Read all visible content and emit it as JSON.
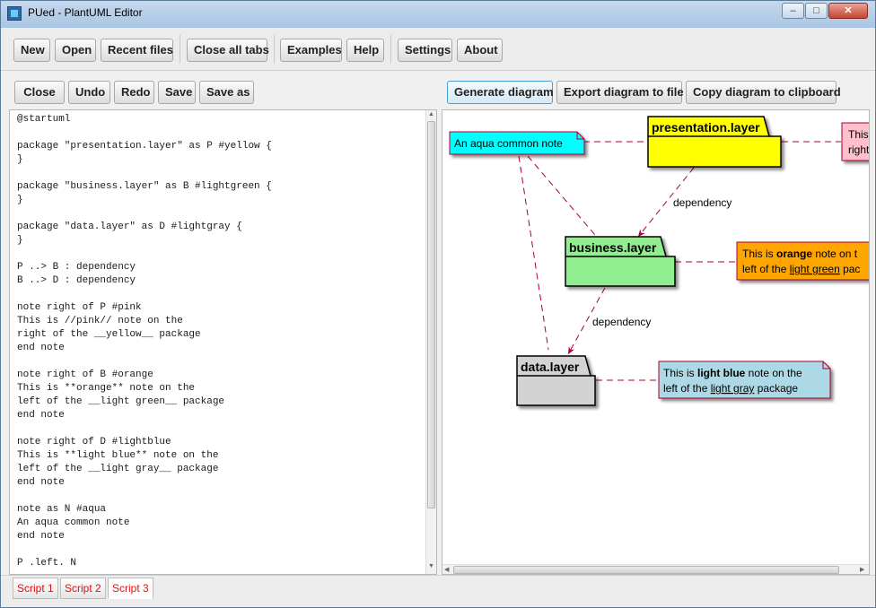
{
  "window": {
    "title": "PUed - PlantUML Editor",
    "min": "–",
    "max": "□",
    "close": "✕"
  },
  "toolbar": {
    "new": "New",
    "open": "Open",
    "recent": "Recent files",
    "close_all": "Close all tabs",
    "examples": "Examples",
    "help": "Help",
    "settings": "Settings",
    "about": "About"
  },
  "editor_toolbar": {
    "close": "Close",
    "undo": "Undo",
    "redo": "Redo",
    "save": "Save",
    "save_as": "Save as"
  },
  "diagram_toolbar": {
    "generate": "Generate diagram",
    "export": "Export diagram to file",
    "copy": "Copy diagram to clipboard"
  },
  "code": "@startuml\n\npackage \"presentation.layer\" as P #yellow {\n}\n\npackage \"business.layer\" as B #lightgreen {\n}\n\npackage \"data.layer\" as D #lightgray {\n}\n\nP ..> B : dependency\nB ..> D : dependency\n\nnote right of P #pink\nThis is //pink// note on the\nright of the __yellow__ package\nend note\n\nnote right of B #orange\nThis is **orange** note on the\nleft of the __light green__ package\nend note\n\nnote right of D #lightblue\nThis is **light blue** note on the\nleft of the __light gray__ package\nend note\n\nnote as N #aqua\nAn aqua common note\nend note\n\nP .left. N",
  "diagram": {
    "packages": {
      "presentation": "presentation.layer",
      "business": "business.layer",
      "data": "data.layer"
    },
    "edges": {
      "p_b": "dependency",
      "b_d": "dependency"
    },
    "notes": {
      "aqua": "An aqua common note",
      "pink_line1": "This",
      "pink_line2": "right",
      "orange_pre": "This is ",
      "orange_bold": "orange",
      "orange_post": " note on t",
      "orange_l2_pre": "left of the ",
      "orange_l2_u": "light green",
      "orange_l2_post": " pac",
      "blue_pre": "This is ",
      "blue_bold": "light blue",
      "blue_post": " note on the",
      "blue_l2_pre": "left of the ",
      "blue_l2_u": "light gray",
      "blue_l2_post": " package"
    },
    "colors": {
      "yellow": "#ffff00",
      "lightgreen": "#90ee90",
      "lightgray": "#d3d3d3",
      "aqua": "#00ffff",
      "pink": "#ffc0cb",
      "orange": "#ffa500",
      "lightblue": "#add8e6",
      "arrow": "#a80036"
    }
  },
  "tabs": [
    "Script 1",
    "Script 2",
    "Script 3"
  ]
}
